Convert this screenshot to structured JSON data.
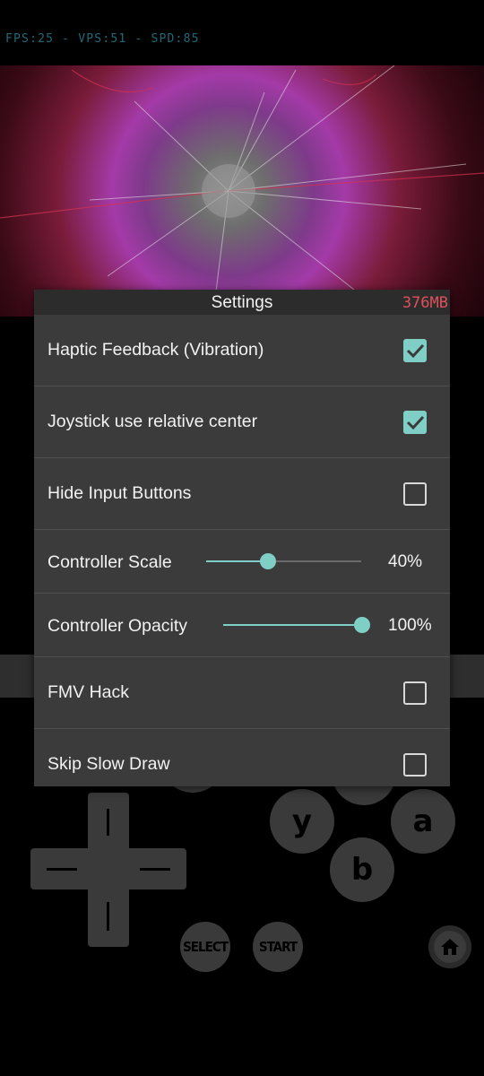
{
  "hud": {
    "stats": "FPS:25 - VPS:51 - SPD:85"
  },
  "settings": {
    "title": "Settings",
    "memory": "376MB",
    "items": [
      {
        "label": "Haptic Feedback (Vibration)",
        "checked": true
      },
      {
        "label": "Joystick use relative center",
        "checked": true
      },
      {
        "label": "Hide Input Buttons",
        "checked": false
      },
      {
        "label": "Controller Scale",
        "value_text": "40%",
        "value": 0.4
      },
      {
        "label": "Controller Opacity",
        "value_text": "100%",
        "value": 1.0
      },
      {
        "label": "FMV Hack",
        "checked": false
      },
      {
        "label": "Skip Slow Draw",
        "checked": false
      }
    ]
  },
  "controller": {
    "y": "y",
    "a": "a",
    "b": "b",
    "select": "SELECT",
    "start": "START",
    "home_icon": "home-icon"
  },
  "colors": {
    "accent": "#7fcfc7",
    "memory": "#e0505a",
    "hud": "#1f6a7a"
  }
}
